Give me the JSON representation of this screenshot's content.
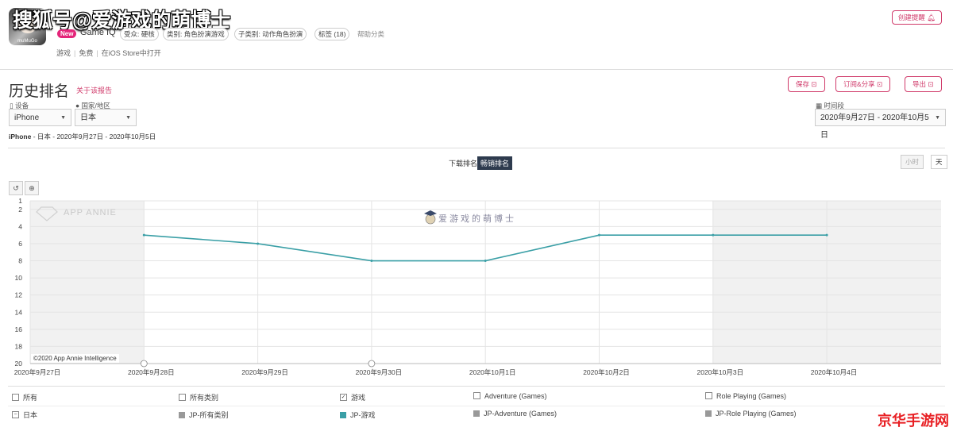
{
  "header": {
    "title_overlay": "搜狐号@爱游戏的萌博士",
    "new_badge": "New",
    "publisher": "Game IQ",
    "tags": [
      "受众: 硬核",
      "类别: 角色扮演游戏",
      "子类别: 动作角色扮演",
      "标签 (18)"
    ],
    "help": "帮助分类",
    "links": [
      "游戏",
      "免费",
      "在iOS Store中打开"
    ],
    "create_alert": "创建提醒",
    "icon_brand": "muMuGo"
  },
  "section": {
    "title": "历史排名",
    "report_link": "关于该报告",
    "actions": [
      "保存",
      "订阅&分享",
      "导出"
    ]
  },
  "filters": {
    "device_label": "设备",
    "device_value": "iPhone",
    "country_label": "国家/地区",
    "country_value": "日本",
    "period_label": "时间段",
    "period_value": "2020年9月27日 - 2020年10月5日"
  },
  "summary": {
    "device": "iPhone",
    "rest": " - 日本 - 2020年9月27日 - 2020年10月5日"
  },
  "rank_tabs": {
    "download": "下载排名",
    "grossing": "畅销排名"
  },
  "granularity": {
    "hour": "小时",
    "day": "天"
  },
  "tools": {
    "reset": "↺",
    "zoom": "⊕"
  },
  "chart_watermarks": {
    "annie": "APP ANNIE",
    "author": "爱游戏的萌博士"
  },
  "copyright": "©2020 App Annie Intelligence",
  "chart_data": {
    "type": "line",
    "x": [
      "2020年9月27日",
      "2020年9月28日",
      "2020年9月29日",
      "2020年9月30日",
      "2020年10月1日",
      "2020年10月2日",
      "2020年10月3日",
      "2020年10月4日"
    ],
    "y_ticks": [
      1,
      2,
      4,
      6,
      8,
      10,
      12,
      14,
      16,
      18,
      20
    ],
    "ylim": [
      20,
      1
    ],
    "y_reversed": true,
    "series": [
      {
        "name": "JP-游戏",
        "color": "#3a9fa6",
        "points": [
          {
            "x": "2020年9月28日",
            "y": 5
          },
          {
            "x": "2020年9月29日",
            "y": 6
          },
          {
            "x": "2020年9月30日",
            "y": 8
          },
          {
            "x": "2020年10月1日",
            "y": 8
          },
          {
            "x": "2020年10月2日",
            "y": 5
          },
          {
            "x": "2020年10月3日",
            "y": 5
          },
          {
            "x": "2020年10月4日",
            "y": 5
          }
        ]
      }
    ],
    "grid": true
  },
  "legend": {
    "row1": [
      {
        "label": "所有",
        "checked": false
      },
      {
        "label": "所有类别",
        "checked": false
      },
      {
        "label": "游戏",
        "checked": true
      },
      {
        "label": "Adventure (Games)",
        "checked": false
      },
      {
        "label": "Role Playing (Games)",
        "checked": false
      }
    ],
    "row2": [
      {
        "label": "日本",
        "color": ""
      },
      {
        "label": "JP-所有类别",
        "color": "#999999"
      },
      {
        "label": "JP-游戏",
        "color": "#3a9fa6"
      },
      {
        "label": "JP-Adventure (Games)",
        "color": "#999999"
      },
      {
        "label": "JP-Role Playing (Games)",
        "color": "#999999"
      }
    ]
  },
  "site_watermark": "京华手游网"
}
